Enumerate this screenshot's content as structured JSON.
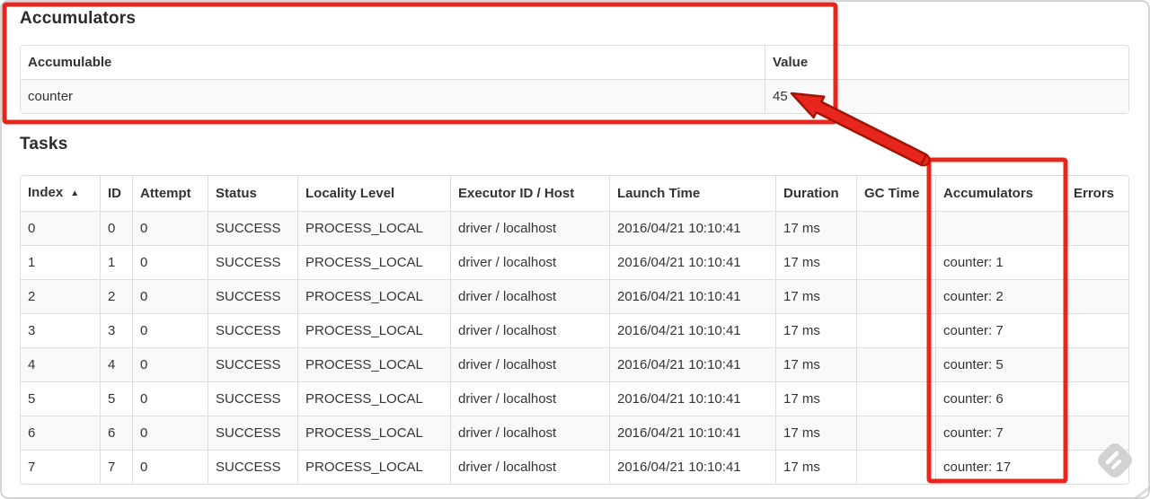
{
  "accumulators": {
    "heading": "Accumulators",
    "columns": [
      "Accumulable",
      "Value"
    ],
    "rows": [
      [
        "counter",
        "45"
      ]
    ]
  },
  "tasks": {
    "heading": "Tasks",
    "columns": [
      "Index",
      "ID",
      "Attempt",
      "Status",
      "Locality Level",
      "Executor ID / Host",
      "Launch Time",
      "Duration",
      "GC Time",
      "Accumulators",
      "Errors"
    ],
    "sort": {
      "column": "Index",
      "icon": "▲",
      "direction": "ascending"
    },
    "rows": [
      [
        "0",
        "0",
        "0",
        "SUCCESS",
        "PROCESS_LOCAL",
        "driver / localhost",
        "2016/04/21 10:10:41",
        "17 ms",
        "",
        "",
        ""
      ],
      [
        "1",
        "1",
        "0",
        "SUCCESS",
        "PROCESS_LOCAL",
        "driver / localhost",
        "2016/04/21 10:10:41",
        "17 ms",
        "",
        "counter: 1",
        ""
      ],
      [
        "2",
        "2",
        "0",
        "SUCCESS",
        "PROCESS_LOCAL",
        "driver / localhost",
        "2016/04/21 10:10:41",
        "17 ms",
        "",
        "counter: 2",
        ""
      ],
      [
        "3",
        "3",
        "0",
        "SUCCESS",
        "PROCESS_LOCAL",
        "driver / localhost",
        "2016/04/21 10:10:41",
        "17 ms",
        "",
        "counter: 7",
        ""
      ],
      [
        "4",
        "4",
        "0",
        "SUCCESS",
        "PROCESS_LOCAL",
        "driver / localhost",
        "2016/04/21 10:10:41",
        "17 ms",
        "",
        "counter: 5",
        ""
      ],
      [
        "5",
        "5",
        "0",
        "SUCCESS",
        "PROCESS_LOCAL",
        "driver / localhost",
        "2016/04/21 10:10:41",
        "17 ms",
        "",
        "counter: 6",
        ""
      ],
      [
        "6",
        "6",
        "0",
        "SUCCESS",
        "PROCESS_LOCAL",
        "driver / localhost",
        "2016/04/21 10:10:41",
        "17 ms",
        "",
        "counter: 7",
        ""
      ],
      [
        "7",
        "7",
        "0",
        "SUCCESS",
        "PROCESS_LOCAL",
        "driver / localhost",
        "2016/04/21 10:10:41",
        "17 ms",
        "",
        "counter: 17",
        ""
      ]
    ]
  },
  "annotation": {
    "color": "#e8261d",
    "highlights": [
      "accumulators-summary-box",
      "accumulators-column-box",
      "arrow-to-total-value"
    ]
  },
  "icons": {
    "sort": "sort-ascending-icon",
    "watermark": "feedly-logo-watermark-icon"
  }
}
